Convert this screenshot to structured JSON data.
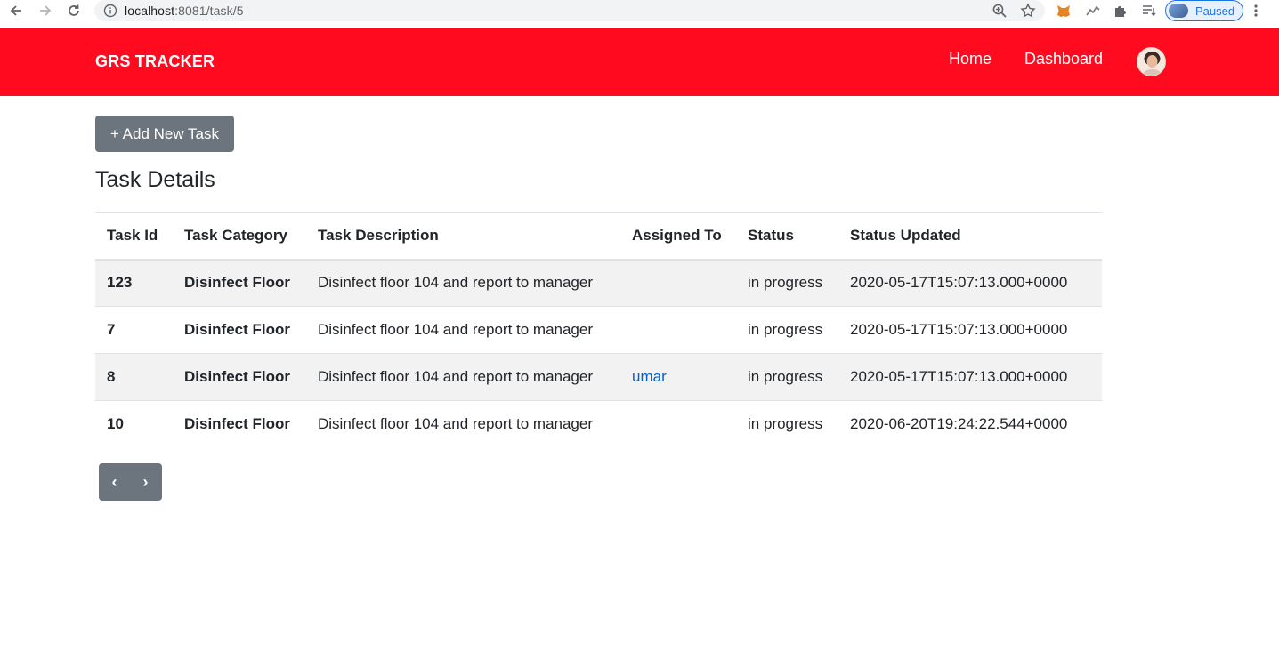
{
  "browser": {
    "url_host": "localhost",
    "url_path": ":8081/task/5",
    "profile_status": "Paused"
  },
  "navbar": {
    "brand": "GRS TRACKER",
    "links": [
      {
        "label": "Home"
      },
      {
        "label": "Dashboard"
      }
    ]
  },
  "main": {
    "add_button_label": "+ Add New Task",
    "title": "Task Details",
    "table": {
      "columns": [
        "Task Id",
        "Task Category",
        "Task Description",
        "Assigned To",
        "Status",
        "Status Updated"
      ],
      "rows": [
        {
          "id": "123",
          "category": "Disinfect Floor",
          "description": "Disinfect floor 104 and report to manager",
          "assigned": "",
          "status": "in progress",
          "updated": "2020-05-17T15:07:13.000+0000"
        },
        {
          "id": "7",
          "category": "Disinfect Floor",
          "description": "Disinfect floor 104 and report to manager",
          "assigned": "",
          "status": "in progress",
          "updated": "2020-05-17T15:07:13.000+0000"
        },
        {
          "id": "8",
          "category": "Disinfect Floor",
          "description": "Disinfect floor 104 and report to manager",
          "assigned": "umar",
          "status": "in progress",
          "updated": "2020-05-17T15:07:13.000+0000"
        },
        {
          "id": "10",
          "category": "Disinfect Floor",
          "description": "Disinfect floor 104 and report to manager",
          "assigned": "",
          "status": "in progress",
          "updated": "2020-06-20T19:24:22.544+0000"
        }
      ]
    },
    "pager": {
      "prev": "‹",
      "next": "›"
    }
  },
  "colors": {
    "navbar": "#ff0a1e",
    "button": "#6c757d",
    "link": "#0062cc",
    "stripe": "#f2f2f2"
  }
}
